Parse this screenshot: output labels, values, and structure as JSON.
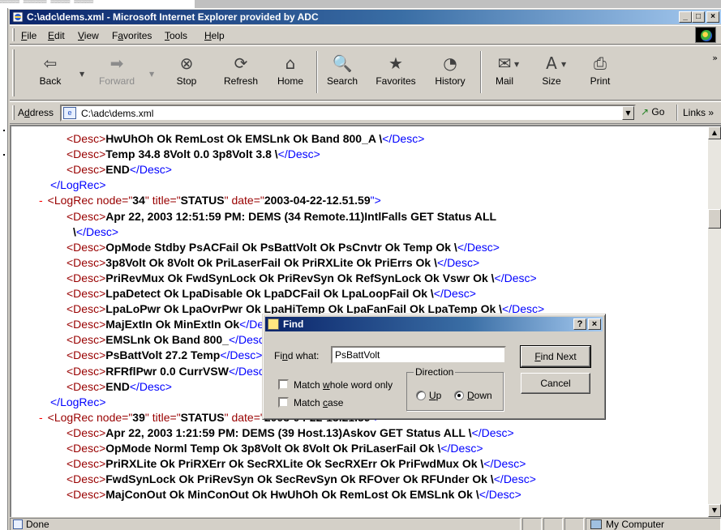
{
  "desktop": {
    "fragment_text": "▒▒▒▒▒ ▒▒▒▒▒▒ ▒▒▒▒▒ ▒▒▒▒▒"
  },
  "window": {
    "title": "C:\\adc\\dems.xml - Microsoft Internet Explorer provided by ADC",
    "minimize": "_",
    "maximize": "□",
    "close": "×"
  },
  "menu": {
    "items": [
      {
        "pre": "",
        "key": "F",
        "post": "ile"
      },
      {
        "pre": "",
        "key": "E",
        "post": "dit"
      },
      {
        "pre": "",
        "key": "V",
        "post": "iew"
      },
      {
        "pre": "F",
        "key": "a",
        "post": "vorites"
      },
      {
        "pre": "",
        "key": "T",
        "post": "ools"
      },
      {
        "pre": "",
        "key": "H",
        "post": "elp"
      }
    ]
  },
  "toolbar": {
    "buttons": [
      {
        "label": "Back",
        "icon": "back-arrow-icon",
        "glyph": "⇦"
      },
      {
        "label": "Forward",
        "icon": "forward-arrow-icon",
        "glyph": "➡"
      },
      {
        "label": "Stop",
        "icon": "stop-icon",
        "glyph": "⊗"
      },
      {
        "label": "Refresh",
        "icon": "refresh-icon",
        "glyph": "⟳"
      },
      {
        "label": "Home",
        "icon": "home-icon",
        "glyph": "⌂"
      },
      {
        "label": "Search",
        "icon": "search-icon",
        "glyph": "🔍"
      },
      {
        "label": "Favorites",
        "icon": "favorites-icon",
        "glyph": "★"
      },
      {
        "label": "History",
        "icon": "history-icon",
        "glyph": "◔"
      },
      {
        "label": "Mail",
        "icon": "mail-icon",
        "glyph": "✉"
      },
      {
        "label": "Size",
        "icon": "font-size-icon",
        "glyph": "A"
      },
      {
        "label": "Print",
        "icon": "print-icon",
        "glyph": "⎙"
      }
    ],
    "more": "»"
  },
  "address": {
    "label_key": "d",
    "label_pre": "A",
    "label_post": "dress",
    "value": "C:\\adc\\dems.xml",
    "go": "Go",
    "links": "Links »"
  },
  "xml": {
    "lines": [
      {
        "indent": 1,
        "kind": "desc",
        "text": "HwUhOh Ok RemLost Ok EMSLnk Ok Band 800_A \\"
      },
      {
        "indent": 1,
        "kind": "desc",
        "text": "Temp 34.8 8Volt 0.0 3p8Volt 3.8 \\"
      },
      {
        "indent": 1,
        "kind": "desc",
        "text": "END"
      },
      {
        "indent": 0,
        "kind": "close",
        "text": "</LogRec>"
      },
      {
        "indent": 0,
        "kind": "open",
        "node": "34",
        "title": "STATUS",
        "date": "2003-04-22-12.51.59"
      },
      {
        "indent": 1,
        "kind": "desc-open",
        "text": "Apr 22, 2003 12:51:59 PM: DEMS (34 Remote.11)IntlFalls GET Status ALL"
      },
      {
        "indent": 2,
        "kind": "desc-tail",
        "text": "\\"
      },
      {
        "indent": 1,
        "kind": "desc",
        "text": "OpMode Stdby PsACFail Ok PsBattVolt Ok PsCnvtr Ok Temp Ok \\"
      },
      {
        "indent": 1,
        "kind": "desc",
        "text": "3p8Volt Ok 8Volt Ok PriLaserFail Ok PriRXLite Ok PriErrs Ok \\"
      },
      {
        "indent": 1,
        "kind": "desc",
        "text": "PriRevMux Ok FwdSynLock Ok PriRevSyn Ok RefSynLock Ok Vswr Ok \\"
      },
      {
        "indent": 1,
        "kind": "desc",
        "text": "LpaDetect Ok LpaDisable Ok LpaDCFail Ok LpaLoopFail Ok \\"
      },
      {
        "indent": 1,
        "kind": "desc",
        "text": "LpaLoPwr Ok LpaOvrPwr Ok LpaHiTemp Ok LpaFanFail Ok LpaTemp Ok \\"
      },
      {
        "indent": 1,
        "kind": "desc",
        "text": "MajExtIn Ok MinExtIn Ok"
      },
      {
        "indent": 1,
        "kind": "desc",
        "text": "EMSLnk Ok Band 800_"
      },
      {
        "indent": 1,
        "kind": "desc",
        "text": "PsBattVolt 27.2 Temp"
      },
      {
        "indent": 1,
        "kind": "desc",
        "text": "RFRflPwr 0.0 CurrVSW"
      },
      {
        "indent": 1,
        "kind": "desc",
        "text": "END"
      },
      {
        "indent": 0,
        "kind": "close",
        "text": "</LogRec>"
      },
      {
        "indent": 0,
        "kind": "open",
        "node": "39",
        "title": "STATUS",
        "date": "2003-04-22-13.21.59"
      },
      {
        "indent": 1,
        "kind": "desc",
        "text": "Apr 22, 2003 1:21:59 PM: DEMS (39 Host.13)Askov GET Status ALL \\"
      },
      {
        "indent": 1,
        "kind": "desc",
        "text": "OpMode Norml Temp Ok 3p8Volt Ok 8Volt Ok PriLaserFail Ok \\"
      },
      {
        "indent": 1,
        "kind": "desc",
        "text": "PriRXLite Ok PriRXErr Ok SecRXLite Ok SecRXErr Ok PriFwdMux Ok \\"
      },
      {
        "indent": 1,
        "kind": "desc",
        "text": "FwdSynLock Ok PriRevSyn Ok SecRevSyn Ok RFOver Ok RFUnder Ok \\"
      },
      {
        "indent": 1,
        "kind": "desc",
        "text": "MajConOut Ok MinConOut Ok HwUhOh Ok RemLost Ok EMSLnk Ok \\"
      }
    ]
  },
  "find": {
    "title": "Find",
    "help": "?",
    "close": "×",
    "label_pre": "Fi",
    "label_key": "n",
    "label_post": "d what:",
    "value": "PsBattVolt",
    "find_next_pre": "",
    "find_next_key": "F",
    "find_next_post": "ind Next",
    "cancel": "Cancel",
    "whole_word_pre": "Match ",
    "whole_word_key": "w",
    "whole_word_post": "hole word only",
    "match_case_pre": "Match ",
    "match_case_key": "c",
    "match_case_post": "ase",
    "direction": "Direction",
    "up_key": "U",
    "up_post": "p",
    "down_key": "D",
    "down_post": "own",
    "whole_word_checked": false,
    "match_case_checked": false,
    "direction_selected": "Down"
  },
  "status": {
    "text": "Done",
    "zone": "My Computer"
  },
  "colors": {
    "title_active": "#0a246a",
    "xml_tag": "#990000",
    "xml_close_blue": "#0000ff",
    "xml_minus": "#ff0000"
  }
}
